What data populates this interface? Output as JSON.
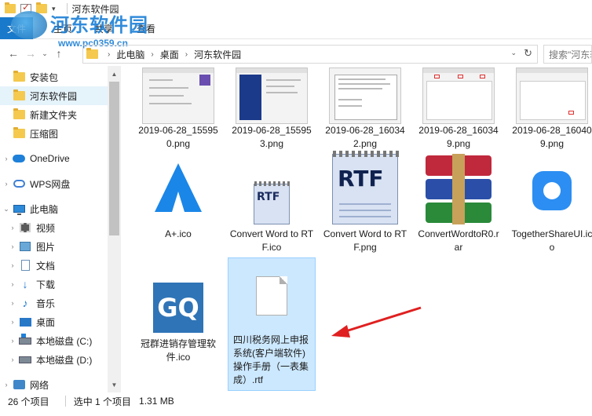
{
  "window": {
    "title": "河东软件园",
    "qa_dropdown": "▾"
  },
  "ribbon": {
    "file_tab": "文件",
    "tabs": [
      "主页",
      "共享",
      "查看"
    ]
  },
  "watermark": {
    "title": "河东软件园",
    "url": "www.pc0359.cn"
  },
  "nav": {
    "back": "←",
    "forward": "→",
    "dropdown": "⌄",
    "up": "↑"
  },
  "address": {
    "crumbs": [
      "此电脑",
      "桌面",
      "河东软件园"
    ],
    "separator": "›",
    "dropdown": "⌄",
    "refresh": "↻"
  },
  "search": {
    "placeholder": "搜索\"河东软件园\""
  },
  "sidebar": {
    "items": [
      {
        "label": "安装包",
        "icon": "folder-icon"
      },
      {
        "label": "河东软件园",
        "icon": "folder-icon",
        "selected": true
      },
      {
        "label": "新建文件夹",
        "icon": "folder-icon"
      },
      {
        "label": "压缩图",
        "icon": "folder-icon"
      },
      {
        "label": "OneDrive",
        "icon": "cloud-icon"
      },
      {
        "label": "WPS网盘",
        "icon": "wps-cloud-icon"
      },
      {
        "label": "此电脑",
        "icon": "computer-icon"
      },
      {
        "label": "视频",
        "icon": "video-icon"
      },
      {
        "label": "图片",
        "icon": "picture-icon"
      },
      {
        "label": "文档",
        "icon": "document-icon"
      },
      {
        "label": "下载",
        "icon": "download-icon"
      },
      {
        "label": "音乐",
        "icon": "music-icon"
      },
      {
        "label": "桌面",
        "icon": "desktop-icon"
      },
      {
        "label": "本地磁盘 (C:)",
        "icon": "drive-c-icon"
      },
      {
        "label": "本地磁盘 (D:)",
        "icon": "drive-d-icon"
      },
      {
        "label": "网络",
        "icon": "network-icon"
      }
    ],
    "chevron_right": "›",
    "chevron_down": "⌄"
  },
  "files": [
    {
      "name": "2019-06-28_155950.png",
      "kind": "screenshot"
    },
    {
      "name": "2019-06-28_155953.png",
      "kind": "screenshot"
    },
    {
      "name": "2019-06-28_160342.png",
      "kind": "screenshot"
    },
    {
      "name": "2019-06-28_160349.png",
      "kind": "screenshot"
    },
    {
      "name": "2019-06-28_160409.png",
      "kind": "screenshot"
    },
    {
      "name": "A+.ico",
      "kind": "icon"
    },
    {
      "name": "Convert Word to RTF.ico",
      "kind": "icon"
    },
    {
      "name": "Convert Word to RTF.png",
      "kind": "image"
    },
    {
      "name": "ConvertWordtoR0.rar",
      "kind": "archive"
    },
    {
      "name": "TogetherShareUI.ico",
      "kind": "icon"
    },
    {
      "name": "冠群进销存管理软件.ico",
      "kind": "icon"
    },
    {
      "name": "四川税务网上申报系统(客户端软件)操作手册（一表集成）.rtf",
      "kind": "document",
      "selected": true
    }
  ],
  "thumb_labels": {
    "rtf": "RTF",
    "gq": "GQ"
  },
  "scrollbar": {
    "up": "▲",
    "down": "▼"
  },
  "status": {
    "item_count": "26 个项目",
    "selection": "选中 1 个项目",
    "size": "1.31 MB"
  },
  "colors": {
    "accent": "#1979ca",
    "selection_bg": "#cce8ff",
    "nav_selected_bg": "#e5f3fb",
    "arrow": "#e02020"
  }
}
